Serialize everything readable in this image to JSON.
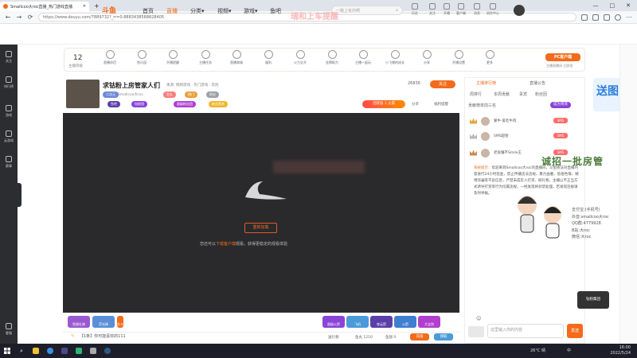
{
  "browser": {
    "tab_title": "Smallcoo大roc直播_热门游戏直播",
    "new_tab": "+",
    "url": "https://www.douyu.com/7889732?_rr=0.8883438588828405",
    "window_controls": [
      "—",
      "□",
      "✕"
    ]
  },
  "header": {
    "logo": "斗鱼",
    "nav": [
      "首页",
      "直播",
      "分类▾",
      "视频▾",
      "游戏▾",
      "鱼吧"
    ],
    "search_placeholder": "一路上有你啊",
    "icons": [
      {
        "label": "历史",
        "icon": "history-icon"
      },
      {
        "label": "关注",
        "icon": "follow-icon"
      },
      {
        "label": "开播",
        "icon": "broadcast-icon"
      },
      {
        "label": "客户端",
        "icon": "client-icon"
      },
      {
        "label": "消息",
        "icon": "message-icon"
      },
      {
        "label": "创作中心",
        "icon": "creator-icon"
      }
    ],
    "accent": "#f36b1b"
  },
  "sidebar": {
    "items": [
      {
        "label": "关注",
        "icon": "heart-icon"
      },
      {
        "label": "排行榜",
        "icon": "rank-icon"
      },
      {
        "label": "游戏",
        "icon": "game-icon"
      },
      {
        "label": "云游戏",
        "icon": "cloud-game-icon"
      },
      {
        "label": "赛事",
        "icon": "trophy-icon"
      },
      {
        "label": "客服",
        "icon": "service-icon"
      }
    ]
  },
  "toolbar": {
    "level": "12",
    "level_label": "主播等级",
    "items": [
      "直播伴侣",
      "鱼乐园",
      "开播提醒",
      "主播任务",
      "直播商城",
      "福利",
      "火力全开",
      "金牌助力",
      "主播一起玩",
      "小飞猪的成长",
      "分享",
      "开播设置",
      "更多"
    ],
    "pc_client": "PC客户端",
    "pc_client_sub": "主播直播间 立即领"
  },
  "room": {
    "title": "求钴粉上房管家人们",
    "category": "来源: 网络游戏 · 热门游戏 · 其他",
    "anchor_name": "Smallcoo大roc",
    "tags": [
      "二次元",
      "鱼丸",
      "热门",
      "粉丝"
    ],
    "pill_labels": [
      "鱼吧",
      "钻粉团",
      "超级粉丝团",
      "粉丝贵宾"
    ],
    "follow_label": "关注",
    "follow_count": "26836",
    "hot_label": "活跃值 1 火箭",
    "share": "分享",
    "report": "福利提醒"
  },
  "player": {
    "reload": "重新加载",
    "tip_prefix": "您还可以",
    "tip_link": "下载客户端",
    "tip_suffix": "观看，获得更稳定的观看体验"
  },
  "gift_bar": {
    "gifts": [
      "鱼翅礼物",
      "荧光棒",
      "办卡",
      "超级火箭",
      "飞机",
      "穿云箭",
      "火箭",
      "大宝剑"
    ],
    "ticker": "【1条】你可能喜欢的111",
    "stats": [
      "送礼物",
      "鱼丸 1210",
      "鱼翅 0",
      "充值"
    ],
    "buttons": [
      "充值",
      "领取"
    ]
  },
  "chat": {
    "tabs": [
      "主播排行榜",
      "直播公告"
    ],
    "subtabs": [
      "周排行",
      "本周贡献",
      "贵宾",
      "粉丝团"
    ],
    "badge": "成为贵宾",
    "rank_title": "贡献榜单前三名",
    "ranks": [
      {
        "name": "蒙牛·爱吃牛肉",
        "tag": "SMS"
      },
      {
        "name": "SMS超管",
        "tag": "SMS"
      },
      {
        "name": "老张懂不Smile王",
        "tag": "SMS"
      }
    ],
    "system_label": "系统提示",
    "system_text": "：欢迎来到Smallcoo大roc的直播间，斗鱼依法对直播内容进行24小时巡查，禁止传播违法违规、暴力血腥、低俗色情、赌博诈骗等不良信息，严禁未成年人打赏、刷礼物，主播以不正当方式诱导打赏等行为均属违规，一经发现将封禁处理。若发现违规请及时举报。",
    "input_placeholder": "这里输入你的内容",
    "send": "发送"
  },
  "overlays": {
    "top": "瑞和上车提醒",
    "side": "诚招一批房管",
    "deco": "送图",
    "credits": [
      "支付宝:(手机号)",
      "抖音:smallcoo大roc",
      "QQ群:4779928",
      "B站:大roc",
      "微信:大roc"
    ],
    "logo": "钻粉集团"
  },
  "taskbar": {
    "weather": "26°C 晴",
    "tray_lang": "中",
    "time": "16:00",
    "date": "2022/5/24",
    "apps": [
      {
        "icon": "file-explorer-icon",
        "color": "#f1c232"
      },
      {
        "icon": "edge-icon",
        "color": "#3c8fe6"
      },
      {
        "icon": "store-icon",
        "color": "#4a4a8a"
      },
      {
        "icon": "chat-icon",
        "color": "#2bb673"
      },
      {
        "icon": "game-icon",
        "color": "#aaa"
      },
      {
        "icon": "steam-icon",
        "color": "#2b5b8a"
      }
    ]
  }
}
